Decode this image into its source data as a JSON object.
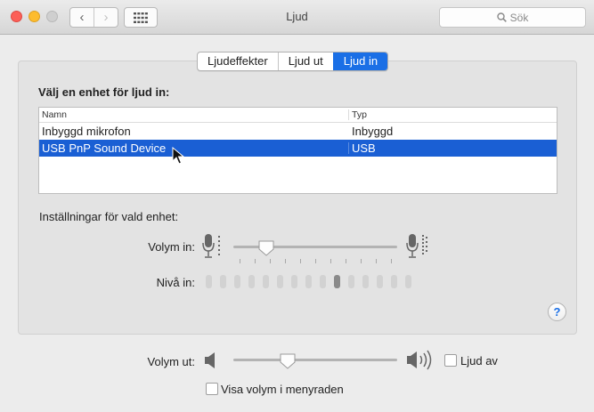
{
  "window": {
    "title": "Ljud"
  },
  "toolbar": {
    "back_glyph": "‹",
    "forward_glyph": "›",
    "search_placeholder": "Sök"
  },
  "tabs": [
    {
      "label": "Ljudeffekter",
      "active": false
    },
    {
      "label": "Ljud ut",
      "active": false
    },
    {
      "label": "Ljud in",
      "active": true
    }
  ],
  "input": {
    "heading": "Välj en enhet för ljud in:",
    "columns": {
      "name": "Namn",
      "type": "Typ"
    },
    "devices": [
      {
        "name": "Inbyggd mikrofon",
        "type": "Inbyggd",
        "selected": false
      },
      {
        "name": "USB PnP Sound Device",
        "type": "USB",
        "selected": true
      }
    ],
    "settings_heading": "Inställningar för vald enhet:",
    "volume_label": "Volym in:",
    "volume_level": 0.2,
    "level_label": "Nivå in:",
    "level_segments": 15,
    "level_lit_index": 9
  },
  "output": {
    "volume_label": "Volym ut:",
    "volume_level": 0.33,
    "mute_label": "Ljud av",
    "mute_checked": false,
    "menubar_label": "Visa volym i menyraden",
    "menubar_checked": false
  },
  "help": {
    "label": "?"
  },
  "colors": {
    "accent": "#1a6fe6",
    "selection": "#1a5fd4"
  },
  "icons": {
    "mic_low": "microphone-low-icon",
    "mic_high": "microphone-high-icon",
    "speaker_low": "speaker-low-icon",
    "speaker_high": "speaker-high-icon"
  }
}
